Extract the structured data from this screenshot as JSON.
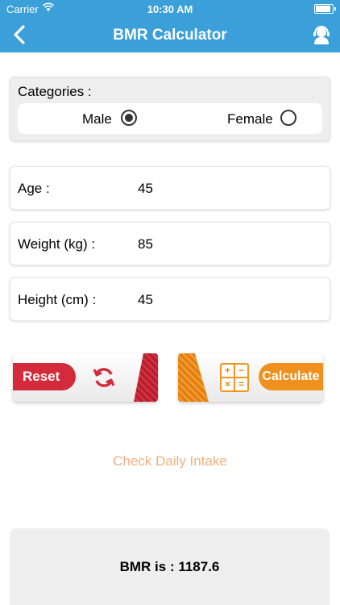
{
  "status_bar": {
    "carrier": "Carrier",
    "time": "10:30 AM"
  },
  "nav": {
    "title": "BMR Calculator",
    "back_icon": "chevron-left-icon",
    "support_icon": "headset-support-icon"
  },
  "categories": {
    "label": "Categories :",
    "options": [
      {
        "label": "Male",
        "selected": true
      },
      {
        "label": "Female",
        "selected": false
      }
    ]
  },
  "fields": {
    "age": {
      "label": "Age :",
      "value": "45"
    },
    "weight": {
      "label": "Weight (kg) :",
      "value": "85"
    },
    "height": {
      "label": "Height (cm) :",
      "value": "45"
    }
  },
  "buttons": {
    "reset": "Reset",
    "calculate": "Calculate",
    "calc_symbols": [
      "+",
      "−",
      "×",
      "="
    ]
  },
  "link": {
    "check_intake": "Check Daily Intake"
  },
  "result": {
    "text": "BMR is : 1187.6"
  },
  "colors": {
    "primary": "#3b9fd9",
    "reset": "#d32a3c",
    "calculate": "#f0901f",
    "link": "#f0b080"
  }
}
